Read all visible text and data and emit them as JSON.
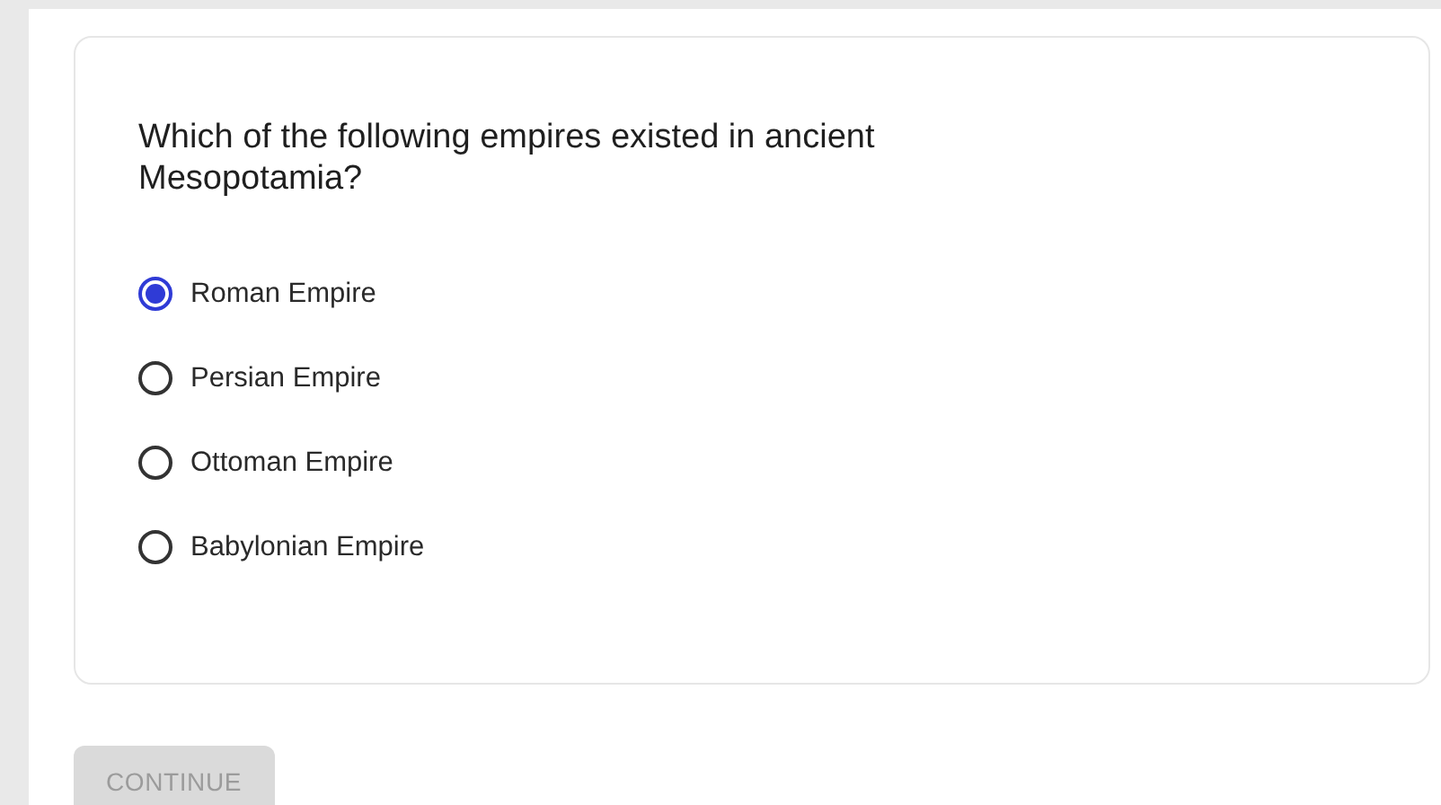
{
  "question": {
    "text": "Which of the following empires existed in ancient Mesopotamia?",
    "options": [
      {
        "label": "Roman Empire",
        "selected": true
      },
      {
        "label": "Persian Empire",
        "selected": false
      },
      {
        "label": "Ottoman Empire",
        "selected": false
      },
      {
        "label": "Babylonian Empire",
        "selected": false
      }
    ]
  },
  "continue_button": {
    "label": "CONTINUE",
    "disabled": true
  }
}
